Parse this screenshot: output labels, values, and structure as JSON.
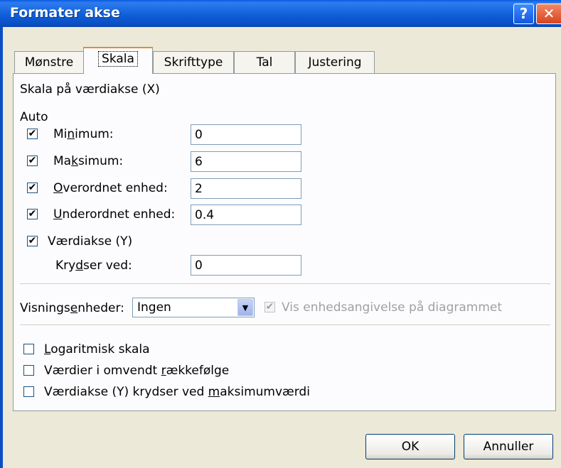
{
  "window": {
    "title": "Formater akse"
  },
  "tabs": [
    "Mønstre",
    "Skala",
    "Skrifttype",
    "Tal",
    "Justering"
  ],
  "scale": {
    "heading": "Skala på værdiakse (X)",
    "auto_label": "Auto",
    "minimum": {
      "pre": "Mi",
      "key": "n",
      "post": "imum:",
      "value": "0",
      "checked": true
    },
    "maximum": {
      "pre": "Ma",
      "key": "k",
      "post": "simum:",
      "value": "6",
      "checked": true
    },
    "major": {
      "pre": "",
      "key": "O",
      "post": "verordnet enhed:",
      "value": "2",
      "checked": true
    },
    "minor": {
      "pre": "",
      "key": "U",
      "post": "nderordnet enhed:",
      "value": "0.4",
      "checked": true
    },
    "value_axis": {
      "label": "Værdiakse (Y)",
      "checked": true
    },
    "crosses_at": {
      "pre": "Kry",
      "key": "d",
      "post": "ser ved:",
      "value": "0"
    }
  },
  "display_units": {
    "pre": "Visnings",
    "key": "e",
    "post": "nheder:",
    "selected": "Ingen",
    "show_label": "Vis enhedsangivelse på diagrammet"
  },
  "options": {
    "log": {
      "pre": "",
      "key": "L",
      "post": "ogaritmisk skala"
    },
    "reverse": {
      "pre": "Værdier i omvendt ",
      "key": "r",
      "post": "ækkefølge"
    },
    "cross_max": {
      "pre": "Værdiakse (Y) krydser ved ",
      "key": "m",
      "post": "aksimumværdi"
    }
  },
  "buttons": {
    "ok": "OK",
    "cancel": "Annuller"
  },
  "icons": {
    "help": "help-icon",
    "close": "close-icon",
    "check": "checkmark-icon",
    "dropdown": "chevron-down-icon"
  }
}
